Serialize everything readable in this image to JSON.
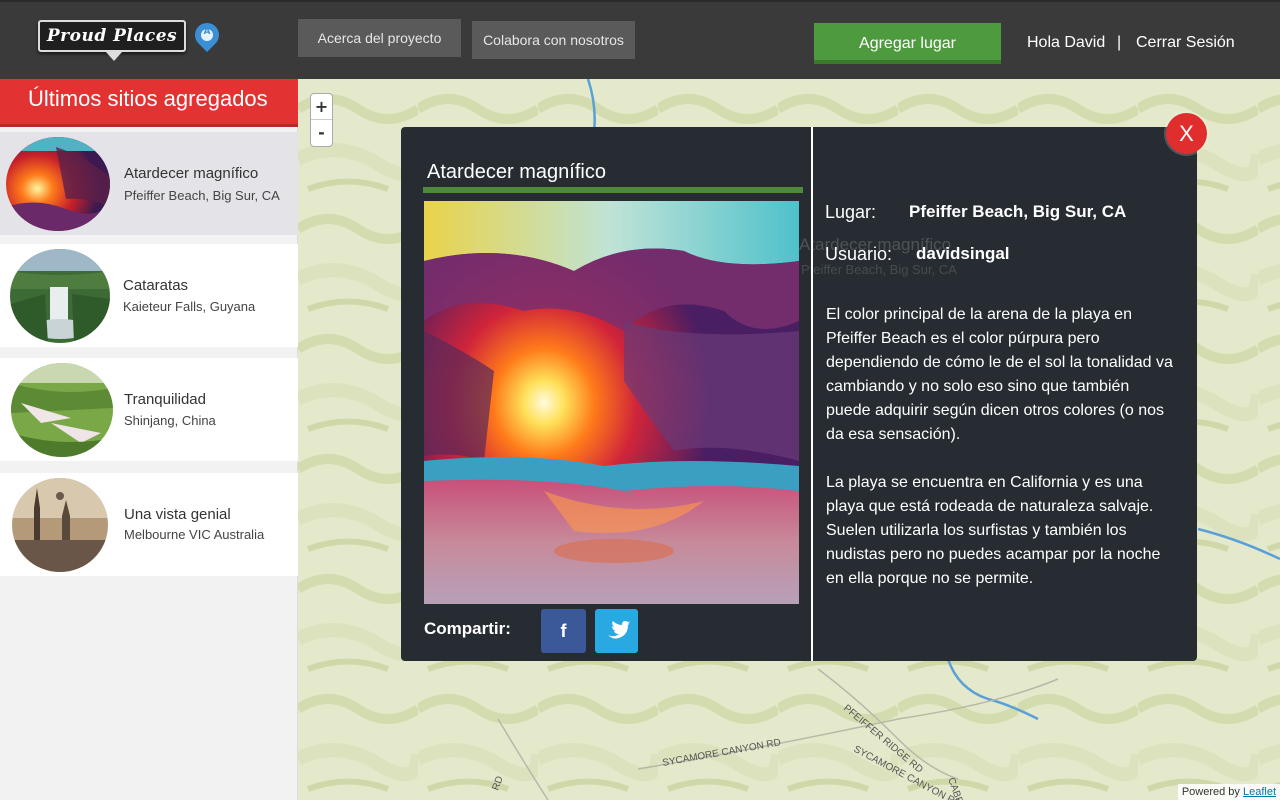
{
  "header": {
    "logo_text": "Proud Places",
    "pin_letter": "A",
    "nav": {
      "about_label": "Acerca del proyecto",
      "collaborate_label": "Colabora con nosotros"
    },
    "add_place_label": "Agregar lugar",
    "greeting": "Hola David",
    "separator": "|",
    "logout_label": "Cerrar Sesión"
  },
  "sidebar": {
    "title": "Últimos sitios agregados",
    "items": [
      {
        "title": "Atardecer magnífico",
        "location": "Pfeiffer Beach, Big Sur, CA",
        "active": true
      },
      {
        "title": "Cataratas",
        "location": "Kaieteur Falls, Guyana",
        "active": false
      },
      {
        "title": "Tranquilidad",
        "location": "Shinjang, China",
        "active": false
      },
      {
        "title": "Una vista genial",
        "location": "Melbourne VIC Australia",
        "active": false
      }
    ]
  },
  "map": {
    "zoom_in": "+",
    "zoom_out": "-",
    "labels": [
      "PFEIFFER RIDGE RD",
      "SYCAMORE CANYON RD",
      "SYCAMORE CANYON RD",
      "CABRILLO",
      "RD"
    ],
    "attribution_prefix": "Powered by",
    "attribution_link": "Leaflet"
  },
  "modal": {
    "title": "Atardecer magnífico",
    "share_label": "Compartir:",
    "facebook_glyph": "f",
    "place_label": "Lugar:",
    "place_value": "Pfeiffer Beach, Big Sur, CA",
    "user_label": "Usuario:",
    "user_value": "davidsingal",
    "ghost_title": "Atardecer magnífico",
    "ghost_location": "Pfeiffer Beach, Big Sur, CA",
    "description": [
      "El color principal de la arena de la playa en Pfeiffer Beach es el color púrpura pero dependiendo de cómo le de el sol la tonalidad va cambiando y no solo eso sino que también puede adquirir según dicen otros colores (o nos da esa sensación).",
      "La playa se encuentra en California y es una playa que está rodeada de naturaleza salvaje. Suelen utilizarla los surfistas y también los nudistas pero no puedes acampar por la noche en ella porque no se permite."
    ],
    "close_label": "X"
  },
  "colors": {
    "header_bg": "#3a3a3a",
    "accent_red": "#e23232",
    "accent_green": "#4e9a3f",
    "modal_bg": "#262c31",
    "facebook": "#3b5998",
    "twitter": "#29a9e1"
  }
}
